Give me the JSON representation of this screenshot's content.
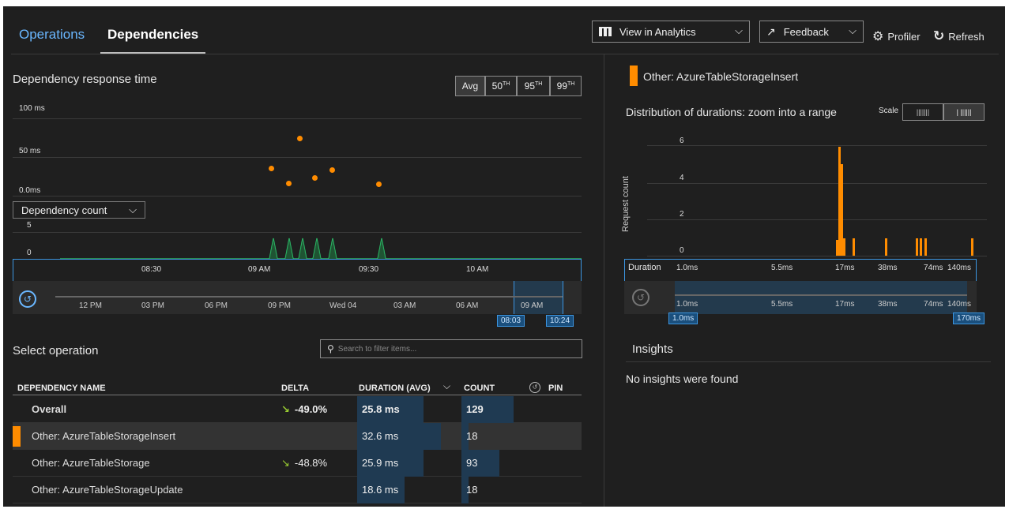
{
  "tabs": {
    "operations": "Operations",
    "dependencies": "Dependencies"
  },
  "toolbar": {
    "view_analytics": "View in Analytics",
    "feedback": "Feedback",
    "profiler": "Profiler",
    "refresh": "Refresh"
  },
  "left_chart": {
    "title": "Dependency response time",
    "percentiles": [
      "Avg",
      "50TH",
      "95TH",
      "99TH"
    ],
    "active_percentile": "Avg",
    "y_labels": [
      "100 ms",
      "50 ms",
      "0.0ms"
    ],
    "points_ms": [
      64,
      34,
      24,
      28,
      32,
      23
    ],
    "count_selector": "Dependency count",
    "count_y_labels": [
      "5",
      "0"
    ],
    "x_labels": [
      "08:30",
      "09 AM",
      "09:30",
      "10 AM"
    ],
    "range_labels": [
      "12 PM",
      "03 PM",
      "06 PM",
      "09 PM",
      "Wed 04",
      "03 AM",
      "06 AM",
      "09 AM"
    ],
    "range_start": "08:03",
    "range_end": "10:24"
  },
  "select_operation": {
    "title": "Select operation",
    "search_placeholder": "Search to filter items...",
    "columns": {
      "name": "DEPENDENCY NAME",
      "delta": "DELTA",
      "duration": "DURATION (AVG)",
      "count": "COUNT",
      "pin": "PIN"
    },
    "rows": [
      {
        "name": "Overall",
        "delta": "-49.0%",
        "duration": "25.8 ms",
        "count": "129",
        "duration_frac": 0.795,
        "count_frac": 1.0
      },
      {
        "name": "Other: AzureTableStorageInsert",
        "delta": "",
        "duration": "32.6 ms",
        "count": "18",
        "duration_frac": 1.0,
        "count_frac": 0.14
      },
      {
        "name": "Other: AzureTableStorage",
        "delta": "-48.8%",
        "duration": "25.9 ms",
        "count": "93",
        "duration_frac": 0.795,
        "count_frac": 0.72
      },
      {
        "name": "Other: AzureTableStorageUpdate",
        "delta": "",
        "duration": "18.6 ms",
        "count": "18",
        "duration_frac": 0.57,
        "count_frac": 0.14
      }
    ]
  },
  "right_panel": {
    "selected_name": "Other: AzureTableStorageInsert",
    "dist_title": "Distribution of durations: zoom into a range",
    "scale_label": "Scale",
    "y_axis_label": "Request count",
    "y_labels": [
      "6",
      "4",
      "2",
      "0"
    ],
    "duration_label": "Duration",
    "x_labels": [
      "1.0ms",
      "5.5ms",
      "17ms",
      "38ms",
      "74ms",
      "140ms"
    ],
    "range_start": "1.0ms",
    "range_end": "170ms",
    "insights_title": "Insights",
    "insights_text": "No insights were found"
  },
  "colors": {
    "accent": "#ff8c00",
    "link": "#6ab7ff",
    "count_line": "#2ecc71"
  }
}
